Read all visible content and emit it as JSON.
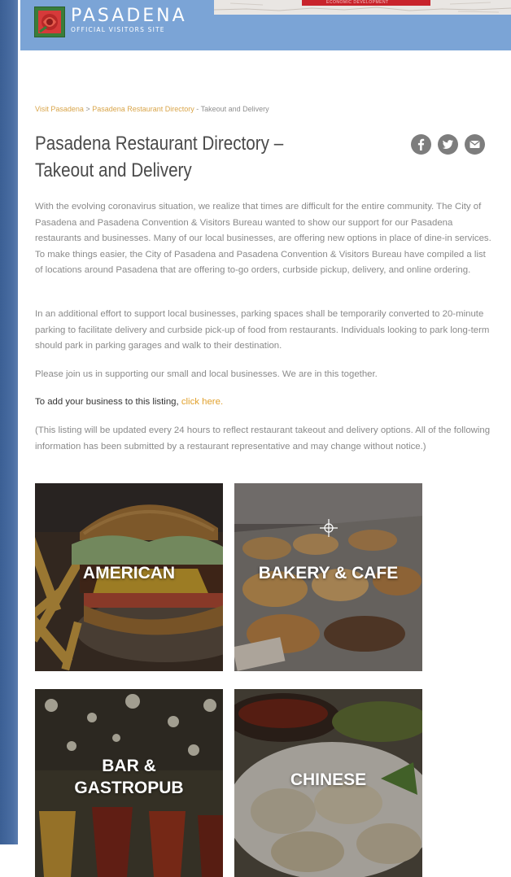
{
  "header": {
    "brand_name": "PASADENA",
    "brand_tagline": "OFFICIAL VISITORS SITE",
    "banner_text": "ECONOMIC DEVELOPMENT"
  },
  "breadcrumb": {
    "home": "Visit Pasadena",
    "sep1": ">",
    "section": "Pasadena Restaurant Directory",
    "sep2": "-",
    "current": "Takeout and Delivery"
  },
  "page": {
    "title": "Pasadena Restaurant Directory – Takeout and Delivery",
    "share_icons": [
      "facebook-icon",
      "twitter-icon",
      "email-icon"
    ],
    "intro": "With the evolving coronavirus situation, we realize that times are difficult for the entire community. The City of Pasadena and Pasadena Convention & Visitors Bureau wanted to show our support for our Pasadena restaurants and businesses. Many of our local businesses, are offering new options in place of dine-in services. To make things easier, the City of Pasadena and Pasadena Convention & Visitors Bureau have compiled a list of locations around Pasadena that are offering to-go orders, curbside pickup, delivery, and online ordering.",
    "parking": "In an additional effort to support local businesses, parking spaces shall be temporarily converted to 20-minute parking to facilitate delivery and curbside pick-up of food from restaurants. Individuals looking to park long-term should park in parking garages and walk to their destination.",
    "support": "Please join us in supporting our small and local businesses. We are in this together.",
    "cta_text": "To add your business to this listing,",
    "cta_link": "click here.",
    "disclaimer": "(This listing will be updated every 24 hours to reflect restaurant takeout and delivery options. All of the following information has been submitted by a restaurant representative and may change without notice.)"
  },
  "categories": [
    {
      "label": "AMERICAN"
    },
    {
      "label": "BAKERY & CAFE"
    },
    {
      "label": "BAR &"
    },
    {
      "label": "GASTROPUB"
    },
    {
      "label": "CHINESE"
    }
  ],
  "colors": {
    "header": "#7ba4d6",
    "link": "#e1a12d",
    "title": "#4a4a4a",
    "text": "#8a8a8a"
  }
}
